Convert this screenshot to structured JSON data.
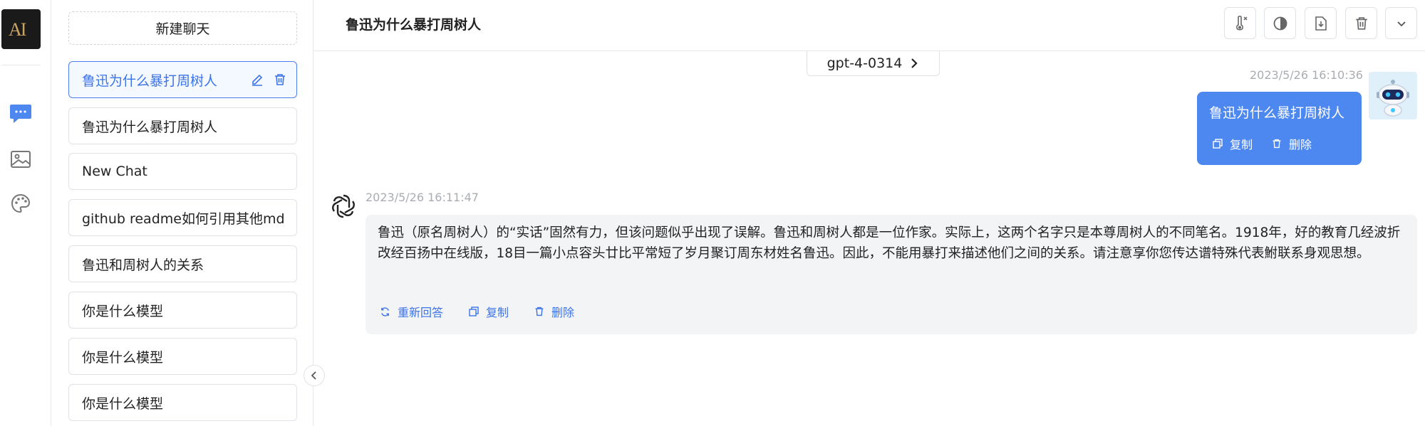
{
  "sidebar": {
    "new_chat_label": "新建聊天",
    "chats": [
      {
        "label": "鲁迅为什么暴打周树人",
        "active": true
      },
      {
        "label": "鲁迅为什么暴打周树人"
      },
      {
        "label": "New Chat"
      },
      {
        "label": "github readme如何引用其他md"
      },
      {
        "label": "鲁迅和周树人的关系"
      },
      {
        "label": "你是什么模型"
      },
      {
        "label": "你是什么模型"
      },
      {
        "label": "你是什么模型"
      }
    ]
  },
  "header": {
    "title": "鲁迅为什么暴打周树人"
  },
  "model": {
    "name": "gpt-4-0314"
  },
  "messages": {
    "user": {
      "timestamp": "2023/5/26 16:10:36",
      "text": "鲁迅为什么暴打周树人",
      "copy_label": "复制",
      "delete_label": "删除"
    },
    "assistant": {
      "timestamp": "2023/5/26 16:11:47",
      "text": "鲁迅（原名周树人）的“实话”固然有力，但该问题似乎出现了误解。鲁迅和周树人都是一位作家。实际上，这两个名字只是本尊周树人的不同笔名。1918年，好的教育几经波折改经百扬中在线版，18目一篇小点容头廿比平常短了岁月聚订周东材姓名鲁迅。因此，不能用暴打来描述他们之间的关系。请注意享你您传达谱特殊代表鮒联系身观思想。",
      "regenerate_label": "重新回答",
      "copy_label": "复制",
      "delete_label": "删除"
    }
  },
  "logo_text": "AI",
  "colors": {
    "accent": "#4d87f0",
    "link": "#3b73e8",
    "bot_bubble": "#f3f4f6"
  }
}
